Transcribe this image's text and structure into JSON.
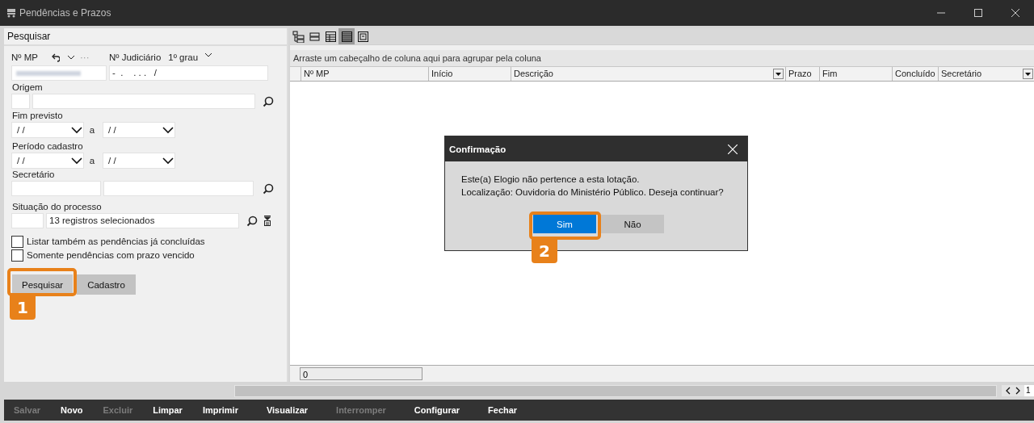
{
  "window": {
    "title": "Pendências e Prazos"
  },
  "search_panel": {
    "title": "Pesquisar",
    "mp_label": "Nº MP",
    "more_label": "···",
    "judicial_label": "Nº Judiciário",
    "degree_label": "1º grau",
    "judicial_value": "-  .    . . .   /",
    "origin_label": "Origem",
    "end_label": "Fim previsto",
    "end_from": "/ /",
    "end_sep": "a",
    "end_to": "/ /",
    "period_label": "Período cadastro",
    "period_from": "/ /",
    "period_sep": "a",
    "period_to": "/ /",
    "secretary_label": "Secretário",
    "status_label": "Situação do processo",
    "status_value": "13 registros selecionados",
    "checkboxes": [
      {
        "label": "Listar também as pendências já concluídas",
        "checked": false
      },
      {
        "label": "Somente pendências com prazo vencido",
        "checked": false
      }
    ],
    "buttons": [
      "Pesquisar",
      "Cadastro"
    ]
  },
  "grid": {
    "views": [
      {
        "selected": false
      },
      {
        "selected": false
      },
      {
        "selected": false
      },
      {
        "selected": true
      },
      {
        "selected": false
      }
    ],
    "group_hint": "Arraste um cabeçalho de coluna aqui para agrupar pela coluna",
    "columns": [
      {
        "label": "Nº MP",
        "dropdown": false
      },
      {
        "label": "Início",
        "dropdown": false
      },
      {
        "label": "Descrição",
        "dropdown": true
      },
      {
        "label": "Prazo",
        "dropdown": false
      },
      {
        "label": "Fim",
        "dropdown": false
      },
      {
        "label": "Concluído",
        "dropdown": false
      },
      {
        "label": "Secretário",
        "dropdown": true
      }
    ],
    "count": "0",
    "page": "1"
  },
  "dialog": {
    "title": "Confirmação",
    "lines": [
      "Este(a) Elogio não pertence a esta lotação.",
      "Localização: Ouvidoria do Ministério Público. Deseja continuar?"
    ],
    "buttons": [
      {
        "label": "Sim",
        "selected": true
      },
      {
        "label": "Não",
        "selected": false
      }
    ]
  },
  "toolbar": [
    {
      "label": "Salvar",
      "disabled": true
    },
    {
      "label": "Novo",
      "disabled": false
    },
    {
      "label": "Excluir",
      "disabled": true
    },
    {
      "label": "Limpar",
      "disabled": false
    },
    {
      "label": "Imprimir",
      "disabled": false
    },
    {
      "label": "Visualizar",
      "disabled": false
    },
    {
      "label": "Interromper",
      "disabled": true
    },
    {
      "label": "Configurar",
      "disabled": false
    },
    {
      "label": "Fechar",
      "disabled": false
    }
  ],
  "annotations": [
    {
      "label": "1"
    },
    {
      "label": "2"
    }
  ]
}
